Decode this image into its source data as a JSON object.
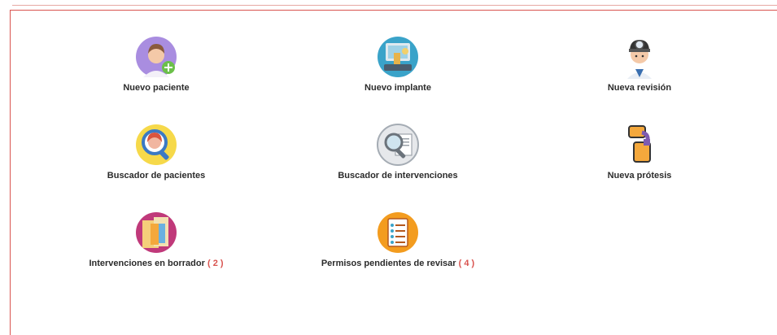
{
  "tiles": [
    {
      "label": "Nuevo paciente",
      "icon": "patient-add-icon"
    },
    {
      "label": "Nuevo implante",
      "icon": "implant-icon"
    },
    {
      "label": "Nueva revisión",
      "icon": "doctor-icon"
    },
    {
      "label": "Buscador de pacientes",
      "icon": "patient-search-icon"
    },
    {
      "label": "Buscador de intervenciones",
      "icon": "intervention-search-icon"
    },
    {
      "label": "Nueva prótesis",
      "icon": "prosthesis-icon"
    },
    {
      "label": "Intervenciones en borrador",
      "icon": "draft-icon",
      "count": "( 2 )"
    },
    {
      "label": "Permisos pendientes de revisar",
      "icon": "checklist-icon",
      "count": "( 4 )"
    }
  ],
  "colors": {
    "accent": "#d9534f",
    "text": "#2b2b2b"
  }
}
